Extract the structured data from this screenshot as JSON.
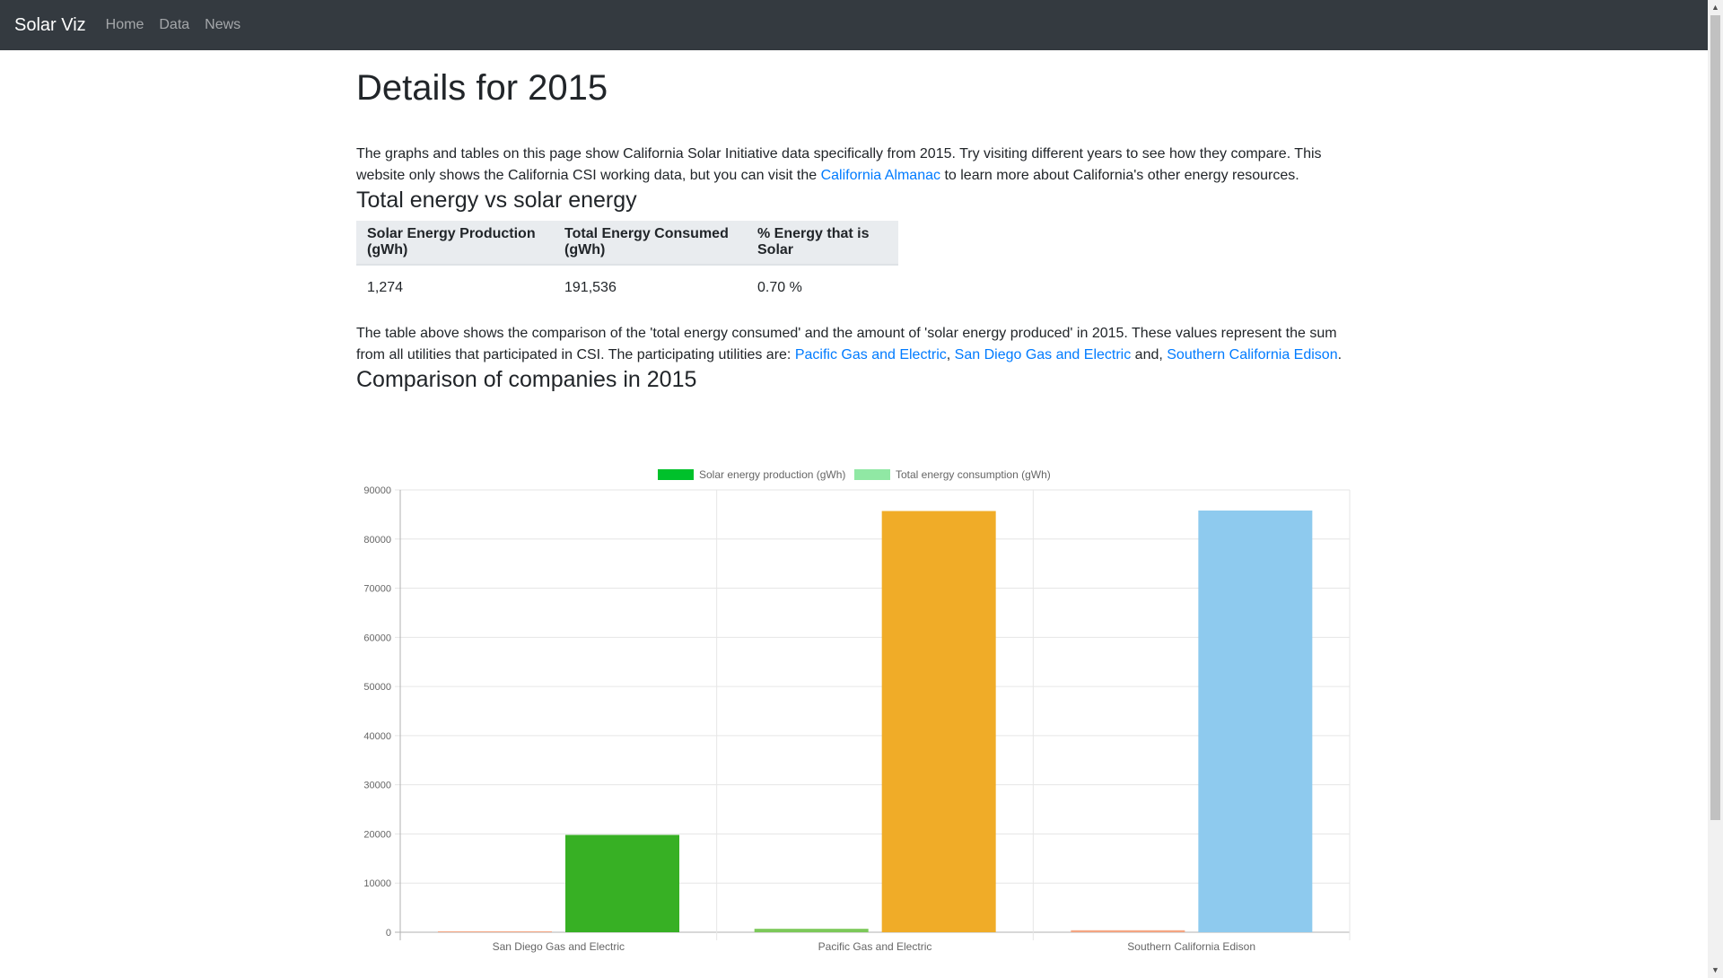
{
  "navbar": {
    "brand": "Solar Viz",
    "links": [
      "Home",
      "Data",
      "News"
    ]
  },
  "page": {
    "title": "Details for 2015",
    "intro_part1": "The graphs and tables on this page show California Solar Initiative data specifically from 2015. Try visiting different years to see how they compare. This website only shows the California CSI working data, but you can visit the ",
    "intro_link": "California Almanac",
    "intro_part2": " to learn more about California's other energy resources."
  },
  "energy_section": {
    "heading": "Total energy vs solar energy",
    "columns": [
      "Solar Energy Production (gWh)",
      "Total Energy Consumed (gWh)",
      "% Energy that is Solar"
    ],
    "row": [
      "1,274",
      "191,536",
      "0.70 %"
    ],
    "after_part1": "The table above shows the comparison of the 'total energy consumed' and the amount of 'solar energy produced' in 2015. These values represent the sum from all utilities that participated in CSI. The participating utilities are: ",
    "link1": "Pacific Gas and Electric",
    "sep1": ", ",
    "link2": "San Diego Gas and Electric",
    "sep2": " and, ",
    "link3": "Southern California Edison",
    "end": "."
  },
  "comparison_section": {
    "heading": "Comparison of companies in 2015"
  },
  "colors": {
    "navbar_bg": "#343a40",
    "link": "#007bff",
    "table_header_bg": "#e9ecef"
  },
  "chart_data": {
    "type": "bar",
    "categories": [
      "San Diego Gas and Electric",
      "Pacific Gas and Electric",
      "Southern California Edison"
    ],
    "series": [
      {
        "name": "Solar energy production (gWh)",
        "values": [
          180,
          700,
          400
        ],
        "legend_color": "#00c12b",
        "bar_colors": [
          "#f4a582",
          "#7cc95a",
          "#f4a582"
        ]
      },
      {
        "name": "Total energy consumption (gWh)",
        "values": [
          19800,
          85700,
          85800
        ],
        "legend_color": "#90e8a4",
        "bar_colors": [
          "#37b024",
          "#f0ac28",
          "#8ecaee"
        ]
      }
    ],
    "yticks": [
      "0",
      "10000",
      "20000",
      "30000",
      "40000",
      "50000",
      "60000",
      "70000",
      "80000",
      "90000"
    ],
    "ylim": [
      0,
      90000
    ],
    "grid": true,
    "legend": "top-center"
  }
}
